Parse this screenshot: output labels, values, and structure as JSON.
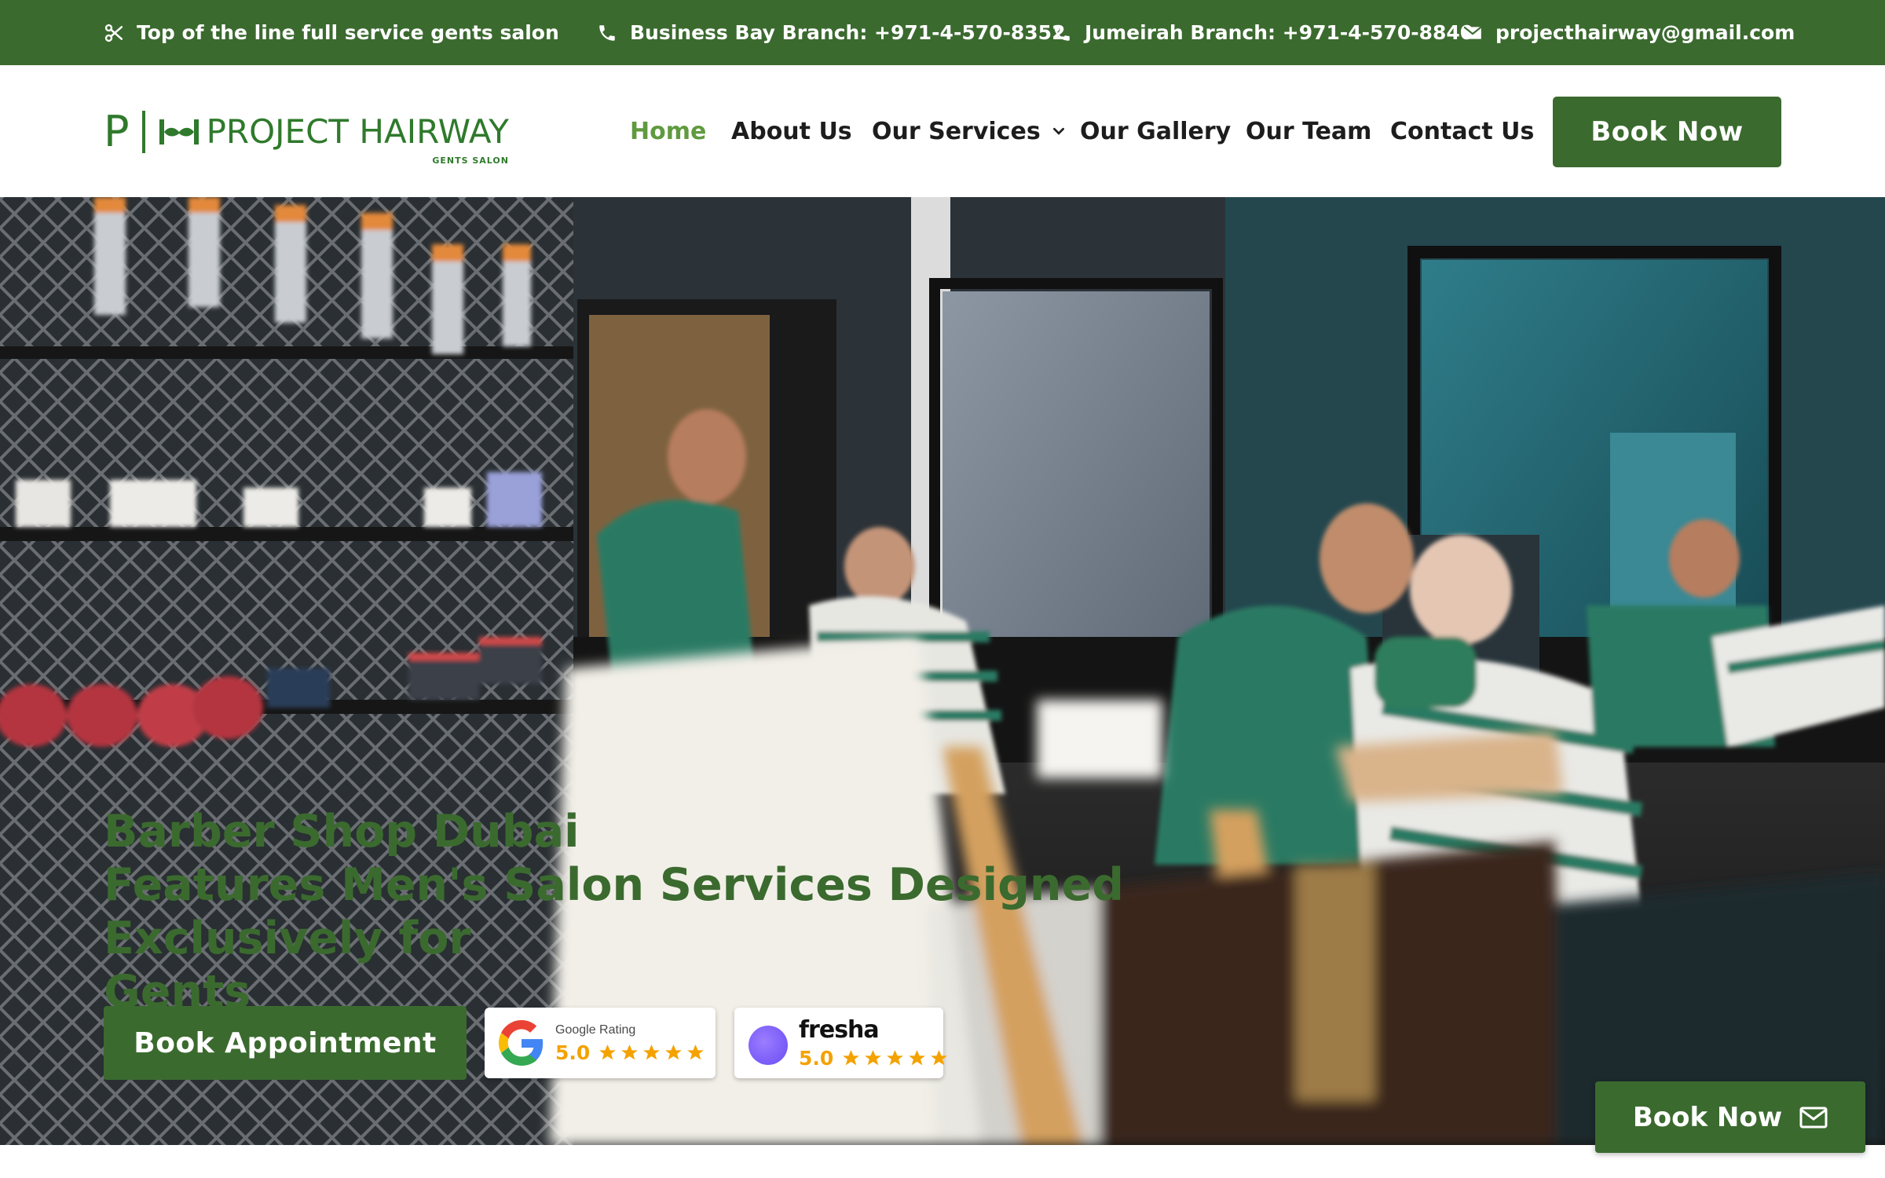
{
  "topbar": {
    "tagline": "Top of the line full service gents salon",
    "business_bay": "Business Bay Branch: +971-4-570-8352",
    "jumeirah": "Jumeirah Branch: +971-4-570-8840",
    "email": "projecthairway@gmail.com",
    "icons": [
      "scissors-icon",
      "phone-icon",
      "phone-icon",
      "envelope-icon"
    ]
  },
  "header": {
    "logo": {
      "initial": "P",
      "name": "PROJECT HAIRWAY",
      "subtitle": "GENTS SALON"
    },
    "nav": [
      {
        "label": "Home",
        "active": true
      },
      {
        "label": "About Us",
        "active": false
      },
      {
        "label": "Our Services",
        "active": false,
        "has_dropdown": true
      },
      {
        "label": "Our Gallery",
        "active": false
      },
      {
        "label": "Our Team",
        "active": false
      },
      {
        "label": "Contact Us",
        "active": false
      }
    ],
    "cta": "Book Now"
  },
  "hero": {
    "title_lines": [
      "Barber Shop Dubai",
      "Features Men's Salon Services Designed Exclusively for",
      "Gents"
    ],
    "cta": "Book Appointment",
    "google_badge": {
      "label": "Google Rating",
      "score": "5.0",
      "stars": 5
    },
    "fresha_badge": {
      "label": "fresha",
      "score": "5.0",
      "stars": 5
    }
  },
  "floating_button": {
    "label": "Book Now",
    "icon": "envelope-icon"
  },
  "colors": {
    "brand_green": "#3b6a2f",
    "logo_green": "#2f7a2c",
    "active_nav": "#5f9a3f",
    "star_gold": "#f4a200"
  }
}
